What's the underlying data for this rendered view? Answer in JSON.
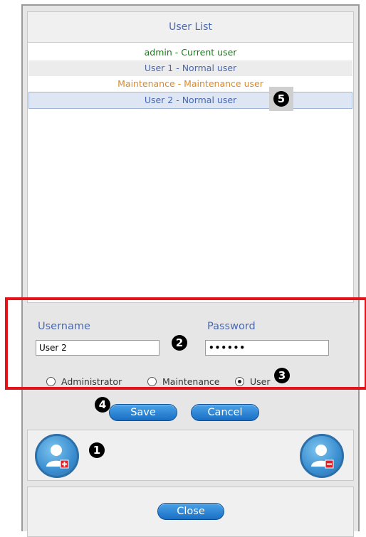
{
  "header": {
    "title": "User List"
  },
  "users": [
    {
      "label": "admin - Current user"
    },
    {
      "label": "User 1 - Normal user"
    },
    {
      "label": "Maintenance - Maintenance user"
    },
    {
      "label": "User 2 - Normal user"
    }
  ],
  "form": {
    "username_label": "Username",
    "password_label": "Password",
    "username_value": "User 2",
    "password_value": "••••••",
    "roles": [
      {
        "label": "Administrator",
        "checked": false
      },
      {
        "label": "Maintenance",
        "checked": false
      },
      {
        "label": "User",
        "checked": true
      }
    ],
    "save_label": "Save",
    "cancel_label": "Cancel"
  },
  "footer": {
    "close_label": "Close"
  },
  "markers": {
    "m1": "1",
    "m2": "2",
    "m3": "3",
    "m4": "4",
    "m5": "5"
  },
  "colors": {
    "accent": "#4a69b3",
    "highlight": "#e1131b",
    "button": "#1a6fc4"
  }
}
